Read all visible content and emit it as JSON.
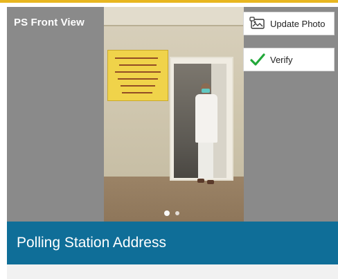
{
  "photo_section": {
    "label": "PS Front View",
    "slide_count": 2,
    "active_slide": 1
  },
  "actions": {
    "update_photo_label": "Update Photo",
    "verify_label": "Verify"
  },
  "address_section": {
    "title": "Polling Station Address"
  },
  "colors": {
    "accent_gold": "#e8b620",
    "header_blue": "#0f6e98",
    "verify_green": "#22a83a",
    "photo_bg_gray": "#8a8a8a"
  },
  "icons": {
    "update_photo": "image-edit-icon",
    "verify": "checkmark-icon"
  }
}
